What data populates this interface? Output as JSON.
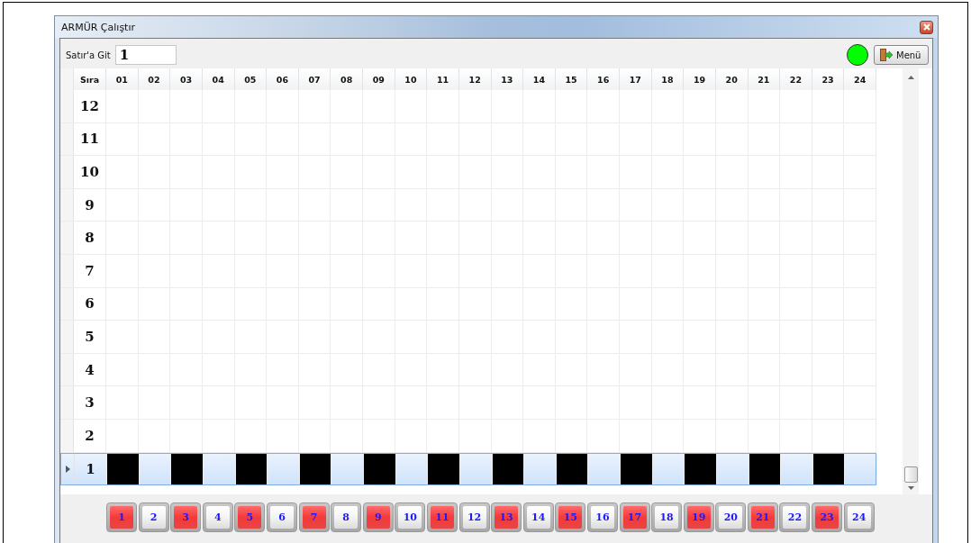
{
  "window": {
    "title": "ARMÜR Çalıştır"
  },
  "goto": {
    "label": "Satır'a Git",
    "value": "1"
  },
  "status": {
    "color": "#00ff00"
  },
  "menu_button": {
    "label": "Menü"
  },
  "grid": {
    "columns": [
      "Sıra",
      "01",
      "02",
      "03",
      "04",
      "05",
      "06",
      "07",
      "08",
      "09",
      "10",
      "11",
      "12",
      "13",
      "14",
      "15",
      "16",
      "17",
      "18",
      "19",
      "20",
      "21",
      "22",
      "23",
      "24"
    ],
    "rows": [
      {
        "label": "12",
        "selected": false,
        "cells": [
          {
            "on": false
          },
          {
            "on": false
          },
          {
            "on": false
          },
          {
            "on": false
          },
          {
            "on": false
          },
          {
            "on": false
          },
          {
            "on": false
          },
          {
            "on": false
          },
          {
            "on": false
          },
          {
            "on": false
          },
          {
            "on": false
          },
          {
            "on": false
          },
          {
            "on": false
          },
          {
            "on": false
          },
          {
            "on": false
          },
          {
            "on": false
          },
          {
            "on": false
          },
          {
            "on": false
          },
          {
            "on": false
          },
          {
            "on": false
          },
          {
            "on": false
          },
          {
            "on": false
          },
          {
            "on": false
          },
          {
            "on": false
          }
        ]
      },
      {
        "label": "11",
        "selected": false,
        "cells": [
          {
            "on": false
          },
          {
            "on": false
          },
          {
            "on": false
          },
          {
            "on": false
          },
          {
            "on": false
          },
          {
            "on": false
          },
          {
            "on": false
          },
          {
            "on": false
          },
          {
            "on": false
          },
          {
            "on": false
          },
          {
            "on": false
          },
          {
            "on": false
          },
          {
            "on": false
          },
          {
            "on": false
          },
          {
            "on": false
          },
          {
            "on": false
          },
          {
            "on": false
          },
          {
            "on": false
          },
          {
            "on": false
          },
          {
            "on": false
          },
          {
            "on": false
          },
          {
            "on": false
          },
          {
            "on": false
          },
          {
            "on": false
          }
        ]
      },
      {
        "label": "10",
        "selected": false,
        "cells": [
          {
            "on": false
          },
          {
            "on": false
          },
          {
            "on": false
          },
          {
            "on": false
          },
          {
            "on": false
          },
          {
            "on": false
          },
          {
            "on": false
          },
          {
            "on": false
          },
          {
            "on": false
          },
          {
            "on": false
          },
          {
            "on": false
          },
          {
            "on": false
          },
          {
            "on": false
          },
          {
            "on": false
          },
          {
            "on": false
          },
          {
            "on": false
          },
          {
            "on": false
          },
          {
            "on": false
          },
          {
            "on": false
          },
          {
            "on": false
          },
          {
            "on": false
          },
          {
            "on": false
          },
          {
            "on": false
          },
          {
            "on": false
          }
        ]
      },
      {
        "label": "9",
        "selected": false,
        "cells": [
          {
            "on": false
          },
          {
            "on": false
          },
          {
            "on": false
          },
          {
            "on": false
          },
          {
            "on": false
          },
          {
            "on": false
          },
          {
            "on": false
          },
          {
            "on": false
          },
          {
            "on": false
          },
          {
            "on": false
          },
          {
            "on": false
          },
          {
            "on": false
          },
          {
            "on": false
          },
          {
            "on": false
          },
          {
            "on": false
          },
          {
            "on": false
          },
          {
            "on": false
          },
          {
            "on": false
          },
          {
            "on": false
          },
          {
            "on": false
          },
          {
            "on": false
          },
          {
            "on": false
          },
          {
            "on": false
          },
          {
            "on": false
          }
        ]
      },
      {
        "label": "8",
        "selected": false,
        "cells": [
          {
            "on": false
          },
          {
            "on": false
          },
          {
            "on": false
          },
          {
            "on": false
          },
          {
            "on": false
          },
          {
            "on": false
          },
          {
            "on": false
          },
          {
            "on": false
          },
          {
            "on": false
          },
          {
            "on": false
          },
          {
            "on": false
          },
          {
            "on": false
          },
          {
            "on": false
          },
          {
            "on": false
          },
          {
            "on": false
          },
          {
            "on": false
          },
          {
            "on": false
          },
          {
            "on": false
          },
          {
            "on": false
          },
          {
            "on": false
          },
          {
            "on": false
          },
          {
            "on": false
          },
          {
            "on": false
          },
          {
            "on": false
          }
        ]
      },
      {
        "label": "7",
        "selected": false,
        "cells": [
          {
            "on": false
          },
          {
            "on": false
          },
          {
            "on": false
          },
          {
            "on": false
          },
          {
            "on": false
          },
          {
            "on": false
          },
          {
            "on": false
          },
          {
            "on": false
          },
          {
            "on": false
          },
          {
            "on": false
          },
          {
            "on": false
          },
          {
            "on": false
          },
          {
            "on": false
          },
          {
            "on": false
          },
          {
            "on": false
          },
          {
            "on": false
          },
          {
            "on": false
          },
          {
            "on": false
          },
          {
            "on": false
          },
          {
            "on": false
          },
          {
            "on": false
          },
          {
            "on": false
          },
          {
            "on": false
          },
          {
            "on": false
          }
        ]
      },
      {
        "label": "6",
        "selected": false,
        "cells": [
          {
            "on": false
          },
          {
            "on": false
          },
          {
            "on": false
          },
          {
            "on": false
          },
          {
            "on": false
          },
          {
            "on": false
          },
          {
            "on": false
          },
          {
            "on": false
          },
          {
            "on": false
          },
          {
            "on": false
          },
          {
            "on": false
          },
          {
            "on": false
          },
          {
            "on": false
          },
          {
            "on": false
          },
          {
            "on": false
          },
          {
            "on": false
          },
          {
            "on": false
          },
          {
            "on": false
          },
          {
            "on": false
          },
          {
            "on": false
          },
          {
            "on": false
          },
          {
            "on": false
          },
          {
            "on": false
          },
          {
            "on": false
          }
        ]
      },
      {
        "label": "5",
        "selected": false,
        "cells": [
          {
            "on": false
          },
          {
            "on": false
          },
          {
            "on": false
          },
          {
            "on": false
          },
          {
            "on": false
          },
          {
            "on": false
          },
          {
            "on": false
          },
          {
            "on": false
          },
          {
            "on": false
          },
          {
            "on": false
          },
          {
            "on": false
          },
          {
            "on": false
          },
          {
            "on": false
          },
          {
            "on": false
          },
          {
            "on": false
          },
          {
            "on": false
          },
          {
            "on": false
          },
          {
            "on": false
          },
          {
            "on": false
          },
          {
            "on": false
          },
          {
            "on": false
          },
          {
            "on": false
          },
          {
            "on": false
          },
          {
            "on": false
          }
        ]
      },
      {
        "label": "4",
        "selected": false,
        "cells": [
          {
            "on": false
          },
          {
            "on": false
          },
          {
            "on": false
          },
          {
            "on": false
          },
          {
            "on": false
          },
          {
            "on": false
          },
          {
            "on": false
          },
          {
            "on": false
          },
          {
            "on": false
          },
          {
            "on": false
          },
          {
            "on": false
          },
          {
            "on": false
          },
          {
            "on": false
          },
          {
            "on": false
          },
          {
            "on": false
          },
          {
            "on": false
          },
          {
            "on": false
          },
          {
            "on": false
          },
          {
            "on": false
          },
          {
            "on": false
          },
          {
            "on": false
          },
          {
            "on": false
          },
          {
            "on": false
          },
          {
            "on": false
          }
        ]
      },
      {
        "label": "3",
        "selected": false,
        "cells": [
          {
            "on": false
          },
          {
            "on": false
          },
          {
            "on": false
          },
          {
            "on": false
          },
          {
            "on": false
          },
          {
            "on": false
          },
          {
            "on": false
          },
          {
            "on": false
          },
          {
            "on": false
          },
          {
            "on": false
          },
          {
            "on": false
          },
          {
            "on": false
          },
          {
            "on": false
          },
          {
            "on": false
          },
          {
            "on": false
          },
          {
            "on": false
          },
          {
            "on": false
          },
          {
            "on": false
          },
          {
            "on": false
          },
          {
            "on": false
          },
          {
            "on": false
          },
          {
            "on": false
          },
          {
            "on": false
          },
          {
            "on": false
          }
        ]
      },
      {
        "label": "2",
        "selected": false,
        "cells": [
          {
            "on": false
          },
          {
            "on": false
          },
          {
            "on": false
          },
          {
            "on": false
          },
          {
            "on": false
          },
          {
            "on": false
          },
          {
            "on": false
          },
          {
            "on": false
          },
          {
            "on": false
          },
          {
            "on": false
          },
          {
            "on": false
          },
          {
            "on": false
          },
          {
            "on": false
          },
          {
            "on": false
          },
          {
            "on": false
          },
          {
            "on": false
          },
          {
            "on": false
          },
          {
            "on": false
          },
          {
            "on": false
          },
          {
            "on": false
          },
          {
            "on": false
          },
          {
            "on": false
          },
          {
            "on": false
          },
          {
            "on": false
          }
        ]
      },
      {
        "label": "1",
        "selected": true,
        "cells": [
          {
            "on": true
          },
          {
            "on": false
          },
          {
            "on": true
          },
          {
            "on": false
          },
          {
            "on": true
          },
          {
            "on": false
          },
          {
            "on": true
          },
          {
            "on": false
          },
          {
            "on": true
          },
          {
            "on": false
          },
          {
            "on": true
          },
          {
            "on": false
          },
          {
            "on": true
          },
          {
            "on": false
          },
          {
            "on": true
          },
          {
            "on": false
          },
          {
            "on": true
          },
          {
            "on": false
          },
          {
            "on": true
          },
          {
            "on": false
          },
          {
            "on": true
          },
          {
            "on": false
          },
          {
            "on": true
          },
          {
            "on": false
          }
        ]
      }
    ]
  },
  "toggles": [
    {
      "label": "1",
      "on": true
    },
    {
      "label": "2",
      "on": false
    },
    {
      "label": "3",
      "on": true
    },
    {
      "label": "4",
      "on": false
    },
    {
      "label": "5",
      "on": true
    },
    {
      "label": "6",
      "on": false
    },
    {
      "label": "7",
      "on": true
    },
    {
      "label": "8",
      "on": false
    },
    {
      "label": "9",
      "on": true
    },
    {
      "label": "10",
      "on": false
    },
    {
      "label": "11",
      "on": true
    },
    {
      "label": "12",
      "on": false
    },
    {
      "label": "13",
      "on": true
    },
    {
      "label": "14",
      "on": false
    },
    {
      "label": "15",
      "on": true
    },
    {
      "label": "16",
      "on": false
    },
    {
      "label": "17",
      "on": true
    },
    {
      "label": "18",
      "on": false
    },
    {
      "label": "19",
      "on": true
    },
    {
      "label": "20",
      "on": false
    },
    {
      "label": "21",
      "on": true
    },
    {
      "label": "22",
      "on": false
    },
    {
      "label": "23",
      "on": true
    },
    {
      "label": "24",
      "on": false
    }
  ]
}
